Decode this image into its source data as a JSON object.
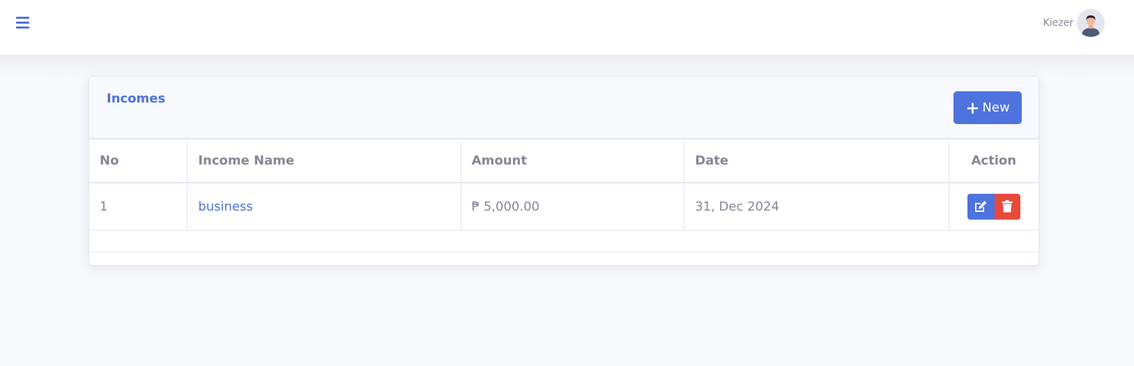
{
  "topbar": {
    "menu_icon": "hamburger-icon",
    "user_name": "Kiezer",
    "avatar_icon": "user-avatar-icon"
  },
  "card": {
    "title": "Incomes",
    "new_button": {
      "icon": "plus-icon",
      "label": "New"
    }
  },
  "table": {
    "columns": [
      "No",
      "Income Name",
      "Amount",
      "Date",
      "Action"
    ],
    "rows": [
      {
        "no": "1",
        "name": "business",
        "amount": "₱ 5,000.00",
        "date": "31, Dec 2024",
        "actions": [
          "edit-icon",
          "trash-icon"
        ]
      }
    ]
  },
  "colors": {
    "primary": "#4e73df",
    "danger": "#e74a3b",
    "text": "#858796",
    "background": "#f8f9fc"
  }
}
